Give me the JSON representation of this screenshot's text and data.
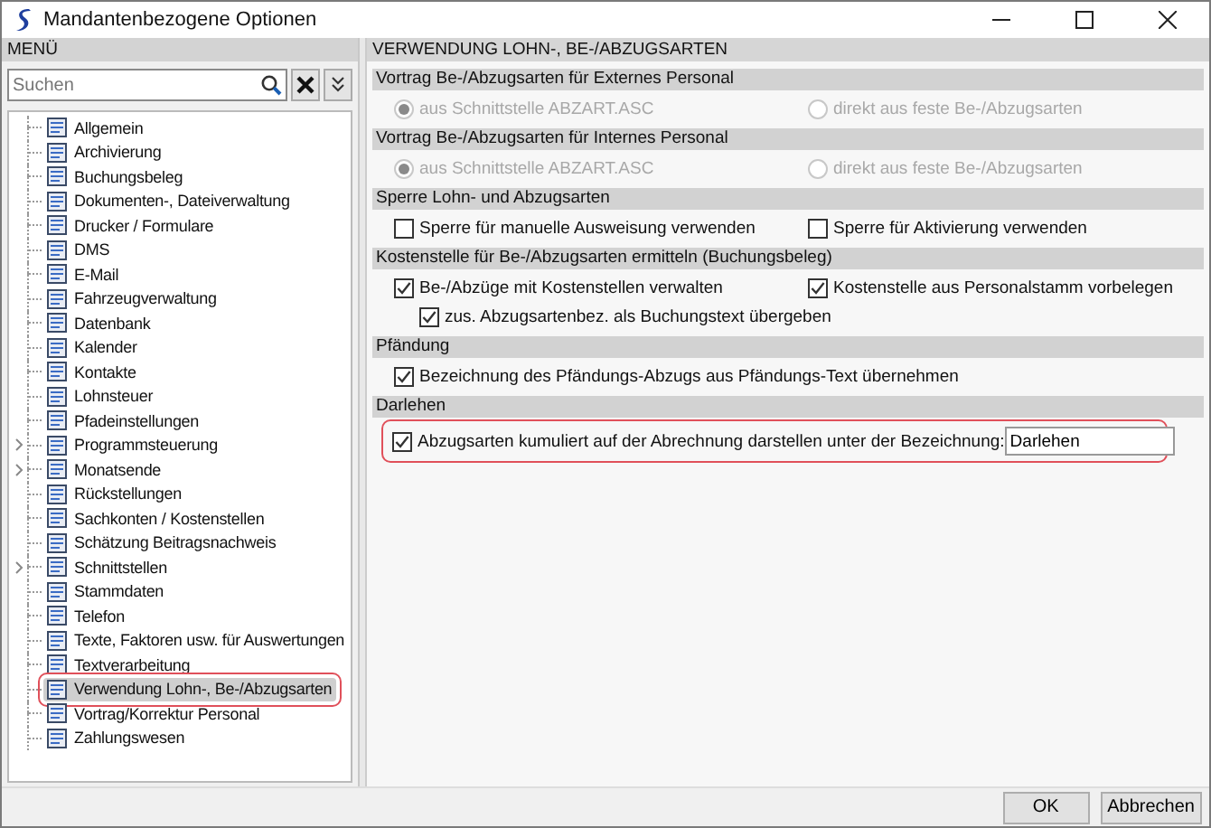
{
  "window": {
    "title": "Mandantenbezogene Optionen"
  },
  "sidebar": {
    "header": "MENÜ",
    "search": {
      "placeholder": "Suchen"
    },
    "items": [
      {
        "label": "Allgemein",
        "selected": false,
        "expandable": false,
        "highlighted": false
      },
      {
        "label": "Archivierung",
        "selected": false,
        "expandable": false,
        "highlighted": false
      },
      {
        "label": "Buchungsbeleg",
        "selected": false,
        "expandable": false,
        "highlighted": false
      },
      {
        "label": "Dokumenten-, Dateiverwaltung",
        "selected": false,
        "expandable": false,
        "highlighted": false
      },
      {
        "label": "Drucker / Formulare",
        "selected": false,
        "expandable": false,
        "highlighted": false
      },
      {
        "label": "DMS",
        "selected": false,
        "expandable": false,
        "highlighted": false
      },
      {
        "label": "E-Mail",
        "selected": false,
        "expandable": false,
        "highlighted": false
      },
      {
        "label": "Fahrzeugverwaltung",
        "selected": false,
        "expandable": false,
        "highlighted": false
      },
      {
        "label": "Datenbank",
        "selected": false,
        "expandable": false,
        "highlighted": false
      },
      {
        "label": "Kalender",
        "selected": false,
        "expandable": false,
        "highlighted": false
      },
      {
        "label": "Kontakte",
        "selected": false,
        "expandable": false,
        "highlighted": false
      },
      {
        "label": "Lohnsteuer",
        "selected": false,
        "expandable": false,
        "highlighted": false
      },
      {
        "label": "Pfadeinstellungen",
        "selected": false,
        "expandable": false,
        "highlighted": false
      },
      {
        "label": "Programmsteuerung",
        "selected": false,
        "expandable": true,
        "highlighted": false
      },
      {
        "label": "Monatsende",
        "selected": false,
        "expandable": true,
        "highlighted": false
      },
      {
        "label": "Rückstellungen",
        "selected": false,
        "expandable": false,
        "highlighted": false
      },
      {
        "label": "Sachkonten / Kostenstellen",
        "selected": false,
        "expandable": false,
        "highlighted": false
      },
      {
        "label": "Schätzung Beitragsnachweis",
        "selected": false,
        "expandable": false,
        "highlighted": false
      },
      {
        "label": "Schnittstellen",
        "selected": false,
        "expandable": true,
        "highlighted": false
      },
      {
        "label": "Stammdaten",
        "selected": false,
        "expandable": false,
        "highlighted": false
      },
      {
        "label": "Telefon",
        "selected": false,
        "expandable": false,
        "highlighted": false
      },
      {
        "label": "Texte, Faktoren usw. für Auswertungen",
        "selected": false,
        "expandable": false,
        "highlighted": false
      },
      {
        "label": "Textverarbeitung",
        "selected": false,
        "expandable": false,
        "highlighted": false
      },
      {
        "label": "Verwendung Lohn-, Be-/Abzugsarten",
        "selected": true,
        "expandable": false,
        "highlighted": true
      },
      {
        "label": "Vortrag/Korrektur Personal",
        "selected": false,
        "expandable": false,
        "highlighted": false
      },
      {
        "label": "Zahlungswesen",
        "selected": false,
        "expandable": false,
        "highlighted": false
      }
    ]
  },
  "panel": {
    "header": "VERWENDUNG LOHN-, BE-/ABZUGSARTEN",
    "sections": [
      {
        "title": "Vortrag Be-/Abzugsarten für Externes Personal",
        "rows": [
          [
            {
              "kind": "radio",
              "label": "aus Schnittstelle ABZART.ASC",
              "selected": true,
              "disabled": true
            },
            {
              "kind": "radio",
              "label": "direkt aus feste Be-/Abzugsarten",
              "selected": false,
              "disabled": true
            }
          ]
        ]
      },
      {
        "title": "Vortrag Be-/Abzugsarten für Internes Personal",
        "rows": [
          [
            {
              "kind": "radio",
              "label": "aus Schnittstelle ABZART.ASC",
              "selected": true,
              "disabled": true
            },
            {
              "kind": "radio",
              "label": "direkt aus feste Be-/Abzugsarten",
              "selected": false,
              "disabled": true
            }
          ]
        ]
      },
      {
        "title": "Sperre Lohn- und Abzugsarten",
        "rows": [
          [
            {
              "kind": "checkbox",
              "label": "Sperre für manuelle Ausweisung verwenden",
              "checked": false
            },
            {
              "kind": "checkbox",
              "label": "Sperre für Aktivierung verwenden",
              "checked": false
            }
          ]
        ]
      },
      {
        "title": "Kostenstelle für Be-/Abzugsarten ermitteln (Buchungsbeleg)",
        "rows": [
          [
            {
              "kind": "checkbox",
              "label": "Be-/Abzüge mit Kostenstellen verwalten",
              "checked": true
            },
            {
              "kind": "checkbox",
              "label": "Kostenstelle aus Personalstamm vorbelegen",
              "checked": true
            }
          ],
          [
            {
              "kind": "subcheckbox",
              "label": "zus. Abzugsartenbez. als Buchungstext übergeben",
              "checked": true
            }
          ]
        ]
      },
      {
        "title": "Pfändung",
        "rows": [
          [
            {
              "kind": "checkbox",
              "label": "Bezeichnung des Pfändungs-Abzugs aus Pfändungs-Text übernehmen",
              "checked": true
            }
          ]
        ]
      },
      {
        "title": "Darlehen",
        "highlighted": true,
        "rows": [
          [
            {
              "kind": "checkfield",
              "label": "Abzugsarten kumuliert auf der Abrechnung darstellen unter der Bezeichnung:",
              "checked": true,
              "value": "Darlehen"
            }
          ]
        ]
      }
    ]
  },
  "buttons": [
    {
      "label": "OK"
    },
    {
      "label": "Abbrechen"
    }
  ]
}
